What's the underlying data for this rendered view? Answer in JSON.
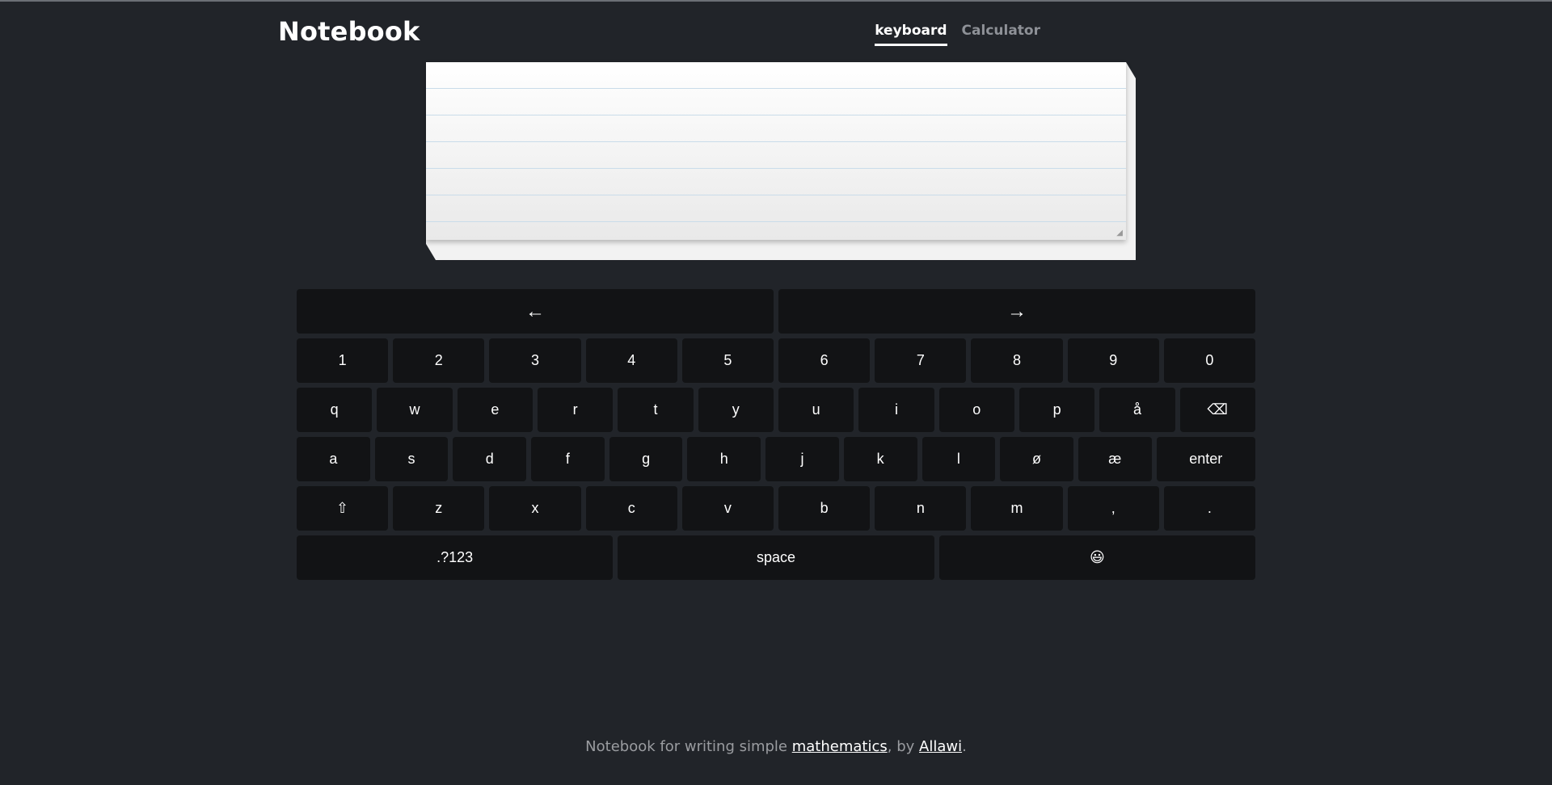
{
  "header": {
    "title": "Notebook",
    "tabs": [
      {
        "label": "keyboard",
        "active": true
      },
      {
        "label": "Calculator",
        "active": false
      }
    ]
  },
  "notebook": {
    "value": "",
    "resize_glyph": "◢"
  },
  "keyboard": {
    "row_arrows": [
      "←",
      "→"
    ],
    "row_numbers": [
      "1",
      "2",
      "3",
      "4",
      "5",
      "6",
      "7",
      "8",
      "9",
      "0"
    ],
    "row_q": [
      "q",
      "w",
      "e",
      "r",
      "t",
      "y",
      "u",
      "i",
      "o",
      "p",
      "å",
      "⌫"
    ],
    "row_a": [
      "a",
      "s",
      "d",
      "f",
      "g",
      "h",
      "j",
      "k",
      "l",
      "ø",
      "æ",
      "enter"
    ],
    "row_z": [
      "⇧",
      "z",
      "x",
      "c",
      "v",
      "b",
      "n",
      "m",
      ",",
      "."
    ],
    "row_bottom": [
      ".?123",
      "space",
      "😃"
    ]
  },
  "footer": {
    "prefix": "Notebook for writing simple ",
    "link1": "mathematics",
    "middle": ", by ",
    "link2": "Allawi",
    "suffix": "."
  },
  "colors": {
    "background": "#212429",
    "key": "#121315",
    "key_text": "#ffffff",
    "tab_inactive": "#8e9197",
    "paper_line": "#c9dcea"
  }
}
